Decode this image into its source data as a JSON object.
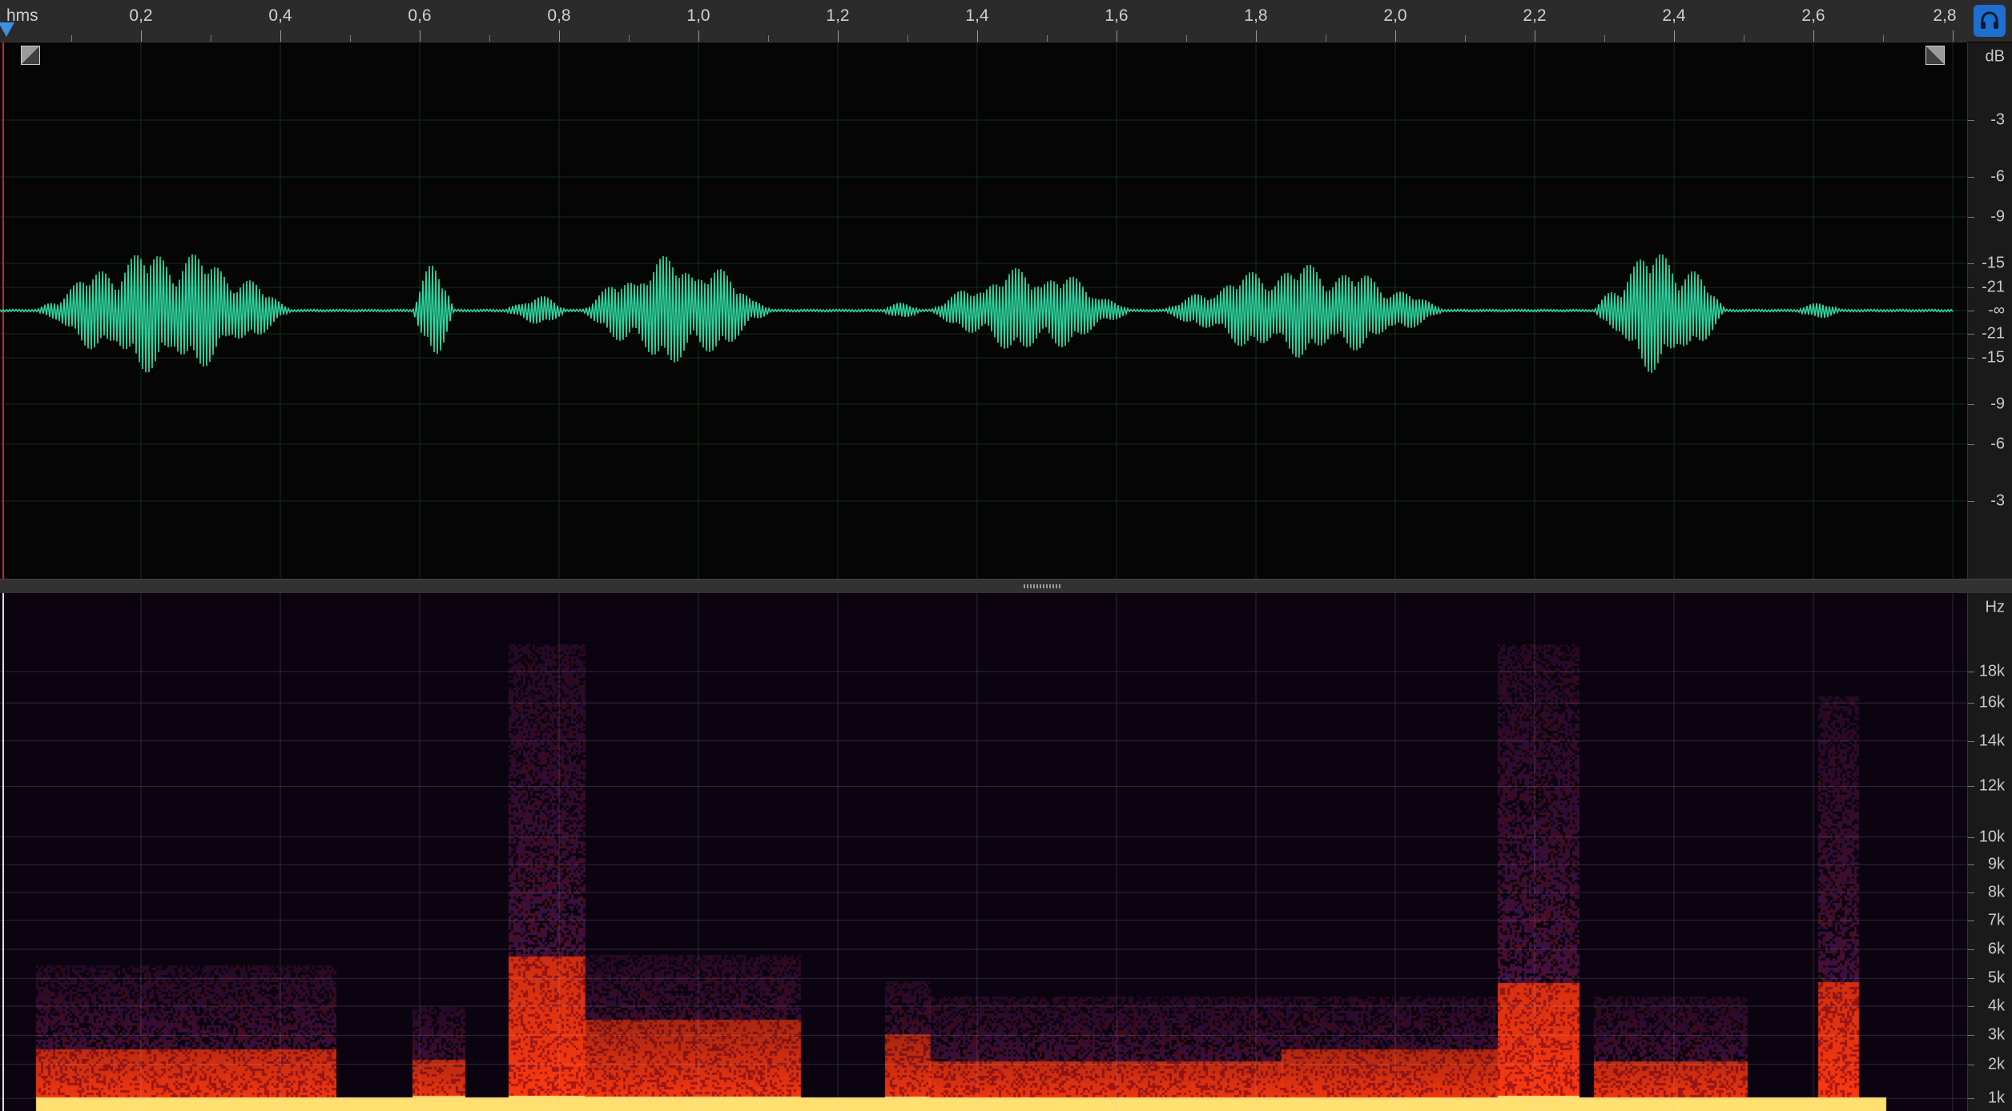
{
  "ruler": {
    "units_label": "hms",
    "ticks": [
      {
        "label": "0,2",
        "t": 0.2
      },
      {
        "label": "0,4",
        "t": 0.4
      },
      {
        "label": "0,6",
        "t": 0.6
      },
      {
        "label": "0,8",
        "t": 0.8
      },
      {
        "label": "1,0",
        "t": 1.0
      },
      {
        "label": "1,2",
        "t": 1.2
      },
      {
        "label": "1,4",
        "t": 1.4
      },
      {
        "label": "1,6",
        "t": 1.6
      },
      {
        "label": "1,8",
        "t": 1.8
      },
      {
        "label": "2,0",
        "t": 2.0
      },
      {
        "label": "2,2",
        "t": 2.2
      },
      {
        "label": "2,4",
        "t": 2.4
      },
      {
        "label": "2,6",
        "t": 2.6
      },
      {
        "label": "2,8",
        "t": 2.8
      }
    ]
  },
  "amplitude_scale": {
    "unit": "dB",
    "labels": [
      "-3",
      "-6",
      "-9",
      "-15",
      "-21",
      "-∞",
      "-21",
      "-15",
      "-9",
      "-6",
      "-3"
    ]
  },
  "frequency_scale": {
    "unit": "Hz",
    "labels": [
      "18k",
      "16k",
      "14k",
      "12k",
      "10k",
      "9k",
      "8k",
      "7k",
      "6k",
      "5k",
      "4k",
      "3k",
      "2k",
      "1k"
    ]
  },
  "colors": {
    "waveform": "#2fd6a0",
    "playhead": "#3d8fe0",
    "monitor_button": "#1f6fd0",
    "spectral_low": "#ffe070",
    "spectral_mid": "#ff3a10",
    "spectral_high": "#4a1450"
  },
  "icons": {
    "monitor": "headphones-icon",
    "fade_in": "fade-in-handle-icon",
    "fade_out": "fade-out-handle-icon"
  }
}
